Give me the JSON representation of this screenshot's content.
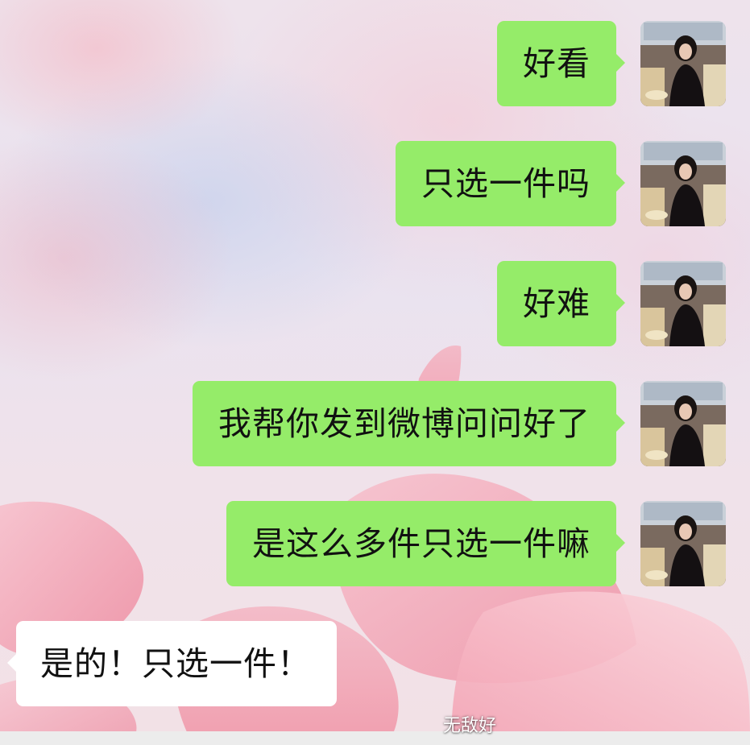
{
  "chat": {
    "messages": [
      {
        "side": "out",
        "text": "好看"
      },
      {
        "side": "out",
        "text": "只选一件吗"
      },
      {
        "side": "out",
        "text": "好难"
      },
      {
        "side": "out",
        "text": "我帮你发到微博问问好了"
      },
      {
        "side": "out",
        "text": "是这么多件只选一件嘛"
      },
      {
        "side": "in",
        "text": "是的！只选一件！"
      }
    ]
  },
  "watermark": {
    "text": "无敌好"
  },
  "colors": {
    "outgoing_bubble": "#95ec69",
    "incoming_bubble": "#ffffff",
    "message_text": "#111111",
    "petal_pink": "#f19aab"
  },
  "icons": {
    "avatar": "avatar-photo-icon"
  }
}
